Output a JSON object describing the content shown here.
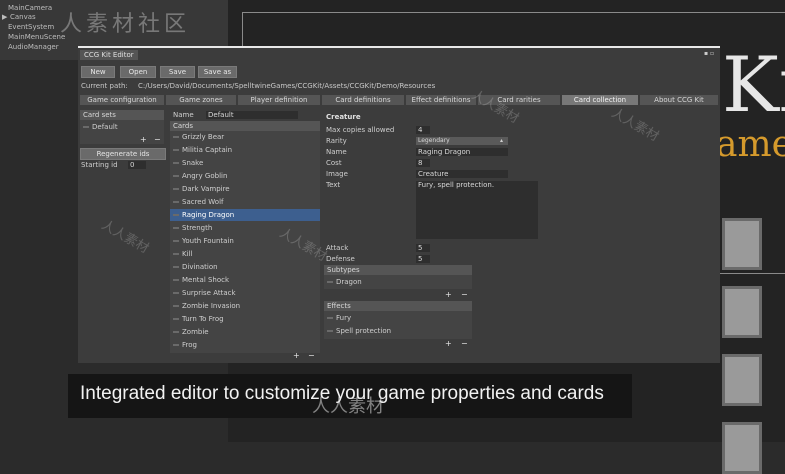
{
  "hierarchy": {
    "items": [
      "MainCamera",
      "Canvas",
      "EventSystem",
      "MainMenuScene",
      "AudioManager"
    ],
    "expand_glyph": "▶"
  },
  "scene": {
    "title_fragment": "Ki",
    "subtitle_fragment": "ame"
  },
  "watermark": {
    "top": "人素材社区",
    "bottom": "人人素材",
    "diag": "人人素材"
  },
  "editor": {
    "title": "CCG Kit Editor",
    "window_controls": "▪ ▫",
    "toolbar": {
      "new": "New",
      "open": "Open",
      "save": "Save",
      "save_as": "Save as"
    },
    "path_label": "Current path:",
    "path_value": "C:/Users/David/Documents/SpelltwineGames/CCGKit/Assets/CCGKit/Demo/Resources",
    "tabs": [
      "Game configuration",
      "Game zones",
      "Player definition",
      "Card definitions",
      "Effect definitions",
      "Card rarities",
      "Card collection",
      "About CCG Kit"
    ],
    "active_tab": "Card collection",
    "card_sets": {
      "header": "Card sets",
      "items": [
        "Default"
      ],
      "plus": "+",
      "minus": "−"
    },
    "regenerate_label": "Regenerate ids",
    "starting_id_label": "Starting id",
    "starting_id_value": "0",
    "set_name_label": "Name",
    "set_name_value": "Default",
    "cards": {
      "header": "Cards",
      "items": [
        "Grizzly Bear",
        "Militia Captain",
        "Snake",
        "Angry Goblin",
        "Dark Vampire",
        "Sacred Wolf",
        "Raging Dragon",
        "Strength",
        "Youth Fountain",
        "Kill",
        "Divination",
        "Mental Shock",
        "Surprise Attack",
        "Zombie Invasion",
        "Turn To Frog",
        "Zombie",
        "Frog"
      ],
      "selected": "Raging Dragon",
      "plus": "+",
      "minus": "−"
    },
    "detail": {
      "type_label": "Creature",
      "max_copies_label": "Max copies allowed",
      "max_copies_value": "4",
      "rarity_label": "Rarity",
      "rarity_value": "Legendary",
      "name_label": "Name",
      "name_value": "Raging Dragon",
      "cost_label": "Cost",
      "cost_value": "8",
      "image_label": "Image",
      "image_value": "Creature",
      "text_label": "Text",
      "text_value": "Fury, spell protection.",
      "attack_label": "Attack",
      "attack_value": "5",
      "defense_label": "Defense",
      "defense_value": "5",
      "subtypes": {
        "header": "Subtypes",
        "items": [
          "Dragon"
        ],
        "plus": "+",
        "minus": "−"
      },
      "effects": {
        "header": "Effects",
        "items": [
          "Fury",
          "Spell protection"
        ],
        "plus": "+",
        "minus": "−"
      }
    }
  },
  "caption": "Integrated editor to customize your game properties and cards",
  "colors": {
    "accent_selection": "#3d5f8f",
    "subtitle_gold": "#d59a2c"
  }
}
